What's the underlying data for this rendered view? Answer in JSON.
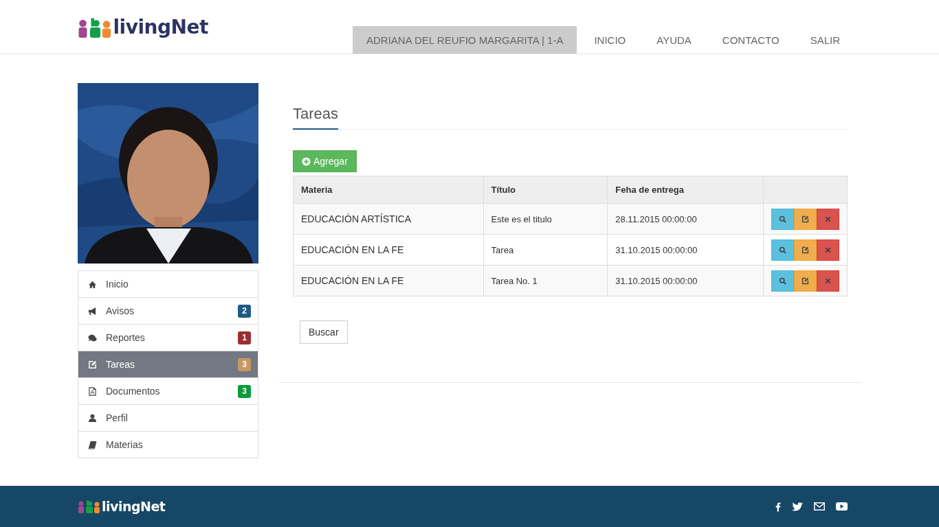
{
  "header": {
    "logo": "livingNet",
    "nav": [
      {
        "label": "ADRIANA DEL REUFIO MARGARITA | 1-A",
        "selected": true
      },
      {
        "label": "INICIO",
        "selected": false
      },
      {
        "label": "AYUDA",
        "selected": false
      },
      {
        "label": "CONTACTO",
        "selected": false
      },
      {
        "label": "SALIR",
        "selected": false
      }
    ]
  },
  "sidebar": {
    "menu": [
      {
        "kind": "home",
        "label": "Inicio",
        "selected": false
      },
      {
        "kind": "megaphone",
        "label": "Avisos",
        "badge": "2",
        "color": "#1f5a85",
        "selected": false
      },
      {
        "kind": "comments",
        "label": "Reportes",
        "badge": "1",
        "color": "#9b2f2f",
        "selected": false
      },
      {
        "kind": "edit",
        "label": "Tareas",
        "badge": "3",
        "color": "#c99762",
        "selected": true
      },
      {
        "kind": "pdf",
        "label": "Documentos",
        "badge": "3",
        "color": "#0a9a3a",
        "selected": false
      },
      {
        "kind": "user",
        "label": "Perfil",
        "selected": false
      },
      {
        "kind": "book",
        "label": "Materias",
        "selected": false
      }
    ]
  },
  "main": {
    "title": "Tareas",
    "add_button": "Agregar",
    "table": {
      "columns": [
        "Materia",
        "Título",
        "Feha de entrega"
      ],
      "rows": [
        {
          "cells": [
            "EDUCACIÓN ARTÍSTICA",
            "Este es el titulo",
            "28.11.2015 00:00:00"
          ]
        },
        {
          "cells": [
            "EDUCACIÓN EN LA FE",
            "Tarea",
            "31.10.2015 00:00:00"
          ]
        },
        {
          "cells": [
            "EDUCACIÓN EN LA FE",
            "Tarea No. 1",
            "31.10.2015 00:00:00"
          ]
        }
      ]
    },
    "search_button": "Buscar"
  },
  "footer": {
    "logo": "livingNet"
  }
}
